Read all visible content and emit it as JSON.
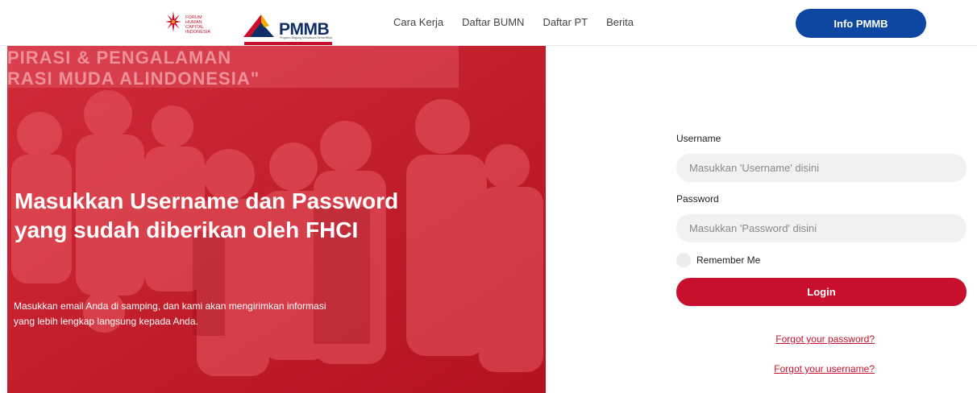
{
  "header": {
    "fhci_logo_text": [
      "FORUM",
      "HUMAN CAPITAL",
      "INDONESIA"
    ],
    "pmmb_logo_text": "PMMB",
    "pmmb_logo_sub": "Program Magang Mahasiswa Bersertifikat",
    "nav": [
      {
        "label": "Cara Kerja"
      },
      {
        "label": "Daftar BUMN"
      },
      {
        "label": "Daftar PT"
      },
      {
        "label": "Berita"
      }
    ],
    "info_button": "Info PMMB"
  },
  "hero": {
    "banner_text_1": "PIRASI & PENGALAMAN",
    "banner_text_2": "RASI MUDA ALINDONESIA\"",
    "title": "Masukkan Username dan Password yang sudah diberikan oleh FHCI",
    "description": "Masukkan email Anda di samping, dan kami akan mengirimkan informasi yang lebih lengkap langsung kepada Anda."
  },
  "form": {
    "username_label": "Username",
    "username_placeholder": "Masukkan 'Username' disini",
    "password_label": "Password",
    "password_placeholder": "Masukkan 'Password' disini",
    "remember_label": "Remember Me",
    "login_label": "Login",
    "forgot_password": "Forgot your password?",
    "forgot_username": "Forgot your username?"
  },
  "colors": {
    "accent_red": "#c8102e",
    "brand_blue": "#0d47a1",
    "hero_overlay": "#c91a2c"
  }
}
